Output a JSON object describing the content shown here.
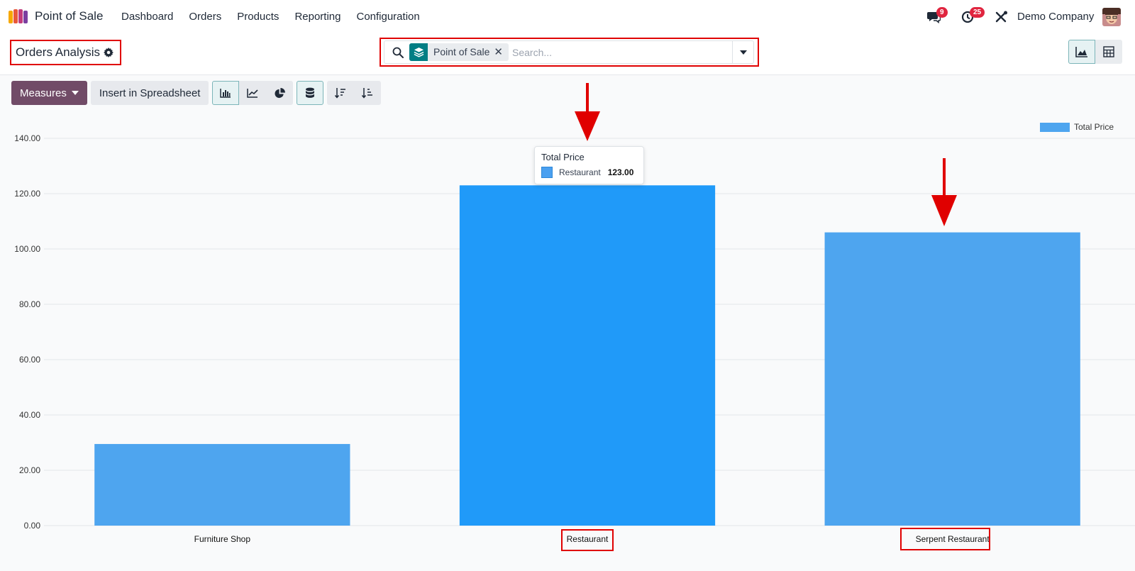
{
  "app": {
    "name": "Point of Sale"
  },
  "nav": {
    "items": [
      {
        "label": "Dashboard"
      },
      {
        "label": "Orders"
      },
      {
        "label": "Products"
      },
      {
        "label": "Reporting"
      },
      {
        "label": "Configuration"
      }
    ]
  },
  "systray": {
    "messages_count": "9",
    "activities_count": "25",
    "company": "Demo Company"
  },
  "control_panel": {
    "title": "Orders Analysis",
    "search": {
      "facet_label": "Point of Sale",
      "facet_remove": "✕",
      "placeholder": "Search..."
    }
  },
  "toolbar": {
    "measures_label": "Measures",
    "insert_label": "Insert in Spreadsheet",
    "active_chart_type": "bar",
    "stacked": true
  },
  "tooltip": {
    "title": "Total Price",
    "series_name": "Restaurant",
    "value": "123.00"
  },
  "colors": {
    "brand": "#714b67",
    "accent": "#017e84",
    "bar": "#4ea5ef",
    "bar_hover": "#209af9",
    "badge": "#e0253f",
    "annotation": "#e00000"
  },
  "chart_data": {
    "type": "bar",
    "categories": [
      "Furniture Shop",
      "Restaurant",
      "Serpent Restaurant"
    ],
    "series": [
      {
        "name": "Total Price",
        "values": [
          29.5,
          123.0,
          106.0
        ]
      }
    ],
    "ylim": [
      0,
      140
    ],
    "yticks": [
      "0.00",
      "20.00",
      "40.00",
      "60.00",
      "80.00",
      "100.00",
      "120.00",
      "140.00"
    ],
    "legend": "top-right",
    "grid": true,
    "highlighted_category": "Restaurant"
  }
}
